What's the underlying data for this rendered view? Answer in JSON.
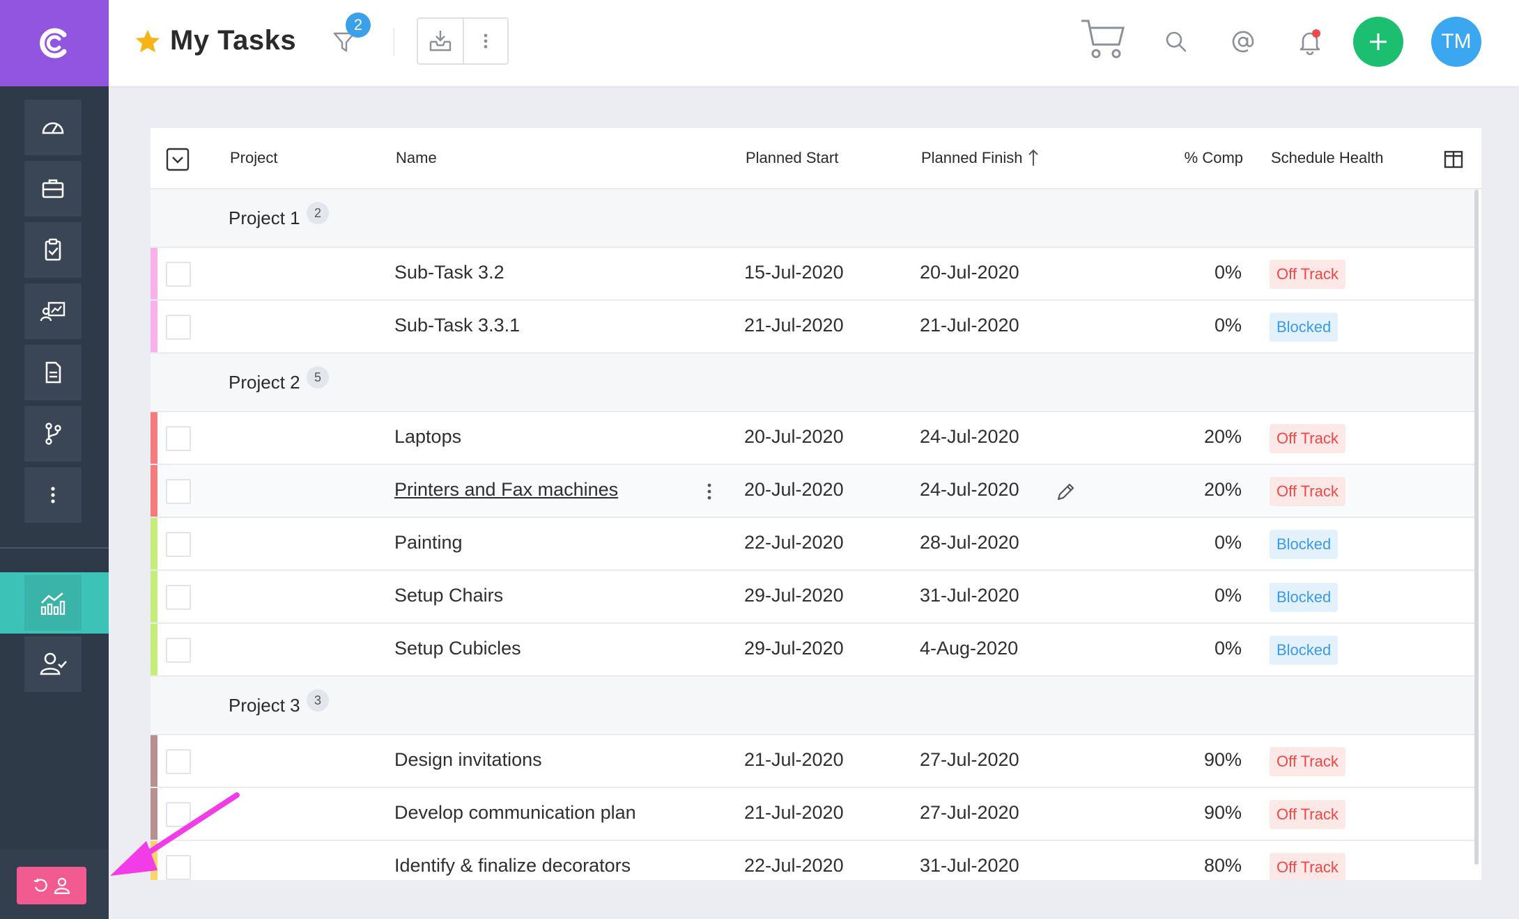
{
  "header": {
    "title": "My Tasks",
    "filter_count": "2",
    "avatar_initials": "TM"
  },
  "sidebar": {
    "items": [
      {
        "name": "dashboard-icon"
      },
      {
        "name": "briefcase-icon"
      },
      {
        "name": "clipboard-check-icon"
      },
      {
        "name": "analytics-board-icon"
      },
      {
        "name": "document-icon"
      },
      {
        "name": "branch-icon"
      },
      {
        "name": "more-vertical-icon"
      }
    ],
    "active": "reports-chart-icon",
    "user_item": "user-check-icon"
  },
  "table": {
    "columns": {
      "project": "Project",
      "name": "Name",
      "planned_start": "Planned Start",
      "planned_finish": "Planned Finish",
      "pct_comp": "% Comp",
      "schedule_health": "Schedule Health"
    },
    "groups": [
      {
        "label": "Project 1",
        "count": "2",
        "rows": [
          {
            "name": "Sub-Task 3.2",
            "start": "15-Jul-2020",
            "finish": "20-Jul-2020",
            "pct": "0%",
            "health": "Off Track"
          },
          {
            "name": "Sub-Task 3.3.1",
            "start": "21-Jul-2020",
            "finish": "21-Jul-2020",
            "pct": "0%",
            "health": "Blocked"
          }
        ]
      },
      {
        "label": "Project 2",
        "count": "5",
        "rows": [
          {
            "name": "Laptops",
            "start": "20-Jul-2020",
            "finish": "24-Jul-2020",
            "pct": "20%",
            "health": "Off Track"
          },
          {
            "name": "Printers and Fax machines",
            "start": "20-Jul-2020",
            "finish": "24-Jul-2020",
            "pct": "20%",
            "health": "Off Track"
          },
          {
            "name": "Painting",
            "start": "22-Jul-2020",
            "finish": "28-Jul-2020",
            "pct": "0%",
            "health": "Blocked"
          },
          {
            "name": "Setup Chairs",
            "start": "29-Jul-2020",
            "finish": "31-Jul-2020",
            "pct": "0%",
            "health": "Blocked"
          },
          {
            "name": "Setup Cubicles",
            "start": "29-Jul-2020",
            "finish": "4-Aug-2020",
            "pct": "0%",
            "health": "Blocked"
          }
        ]
      },
      {
        "label": "Project 3",
        "count": "3",
        "rows": [
          {
            "name": "Design invitations",
            "start": "21-Jul-2020",
            "finish": "27-Jul-2020",
            "pct": "90%",
            "health": "Off Track"
          },
          {
            "name": "Develop communication plan",
            "start": "21-Jul-2020",
            "finish": "27-Jul-2020",
            "pct": "90%",
            "health": "Off Track"
          },
          {
            "name": "Identify & finalize decorators",
            "start": "22-Jul-2020",
            "finish": "31-Jul-2020",
            "pct": "80%",
            "health": "Off Track"
          }
        ]
      }
    ]
  },
  "colors": {
    "brand": "#9155e0",
    "sidebar": "#2f3a48",
    "active": "#3cc2b6",
    "add": "#1cbf6f",
    "avatar": "#3aa7f0",
    "off_track": "#f04646",
    "blocked": "#3a9ae8",
    "annotation_arrow": "#f23ce8"
  }
}
